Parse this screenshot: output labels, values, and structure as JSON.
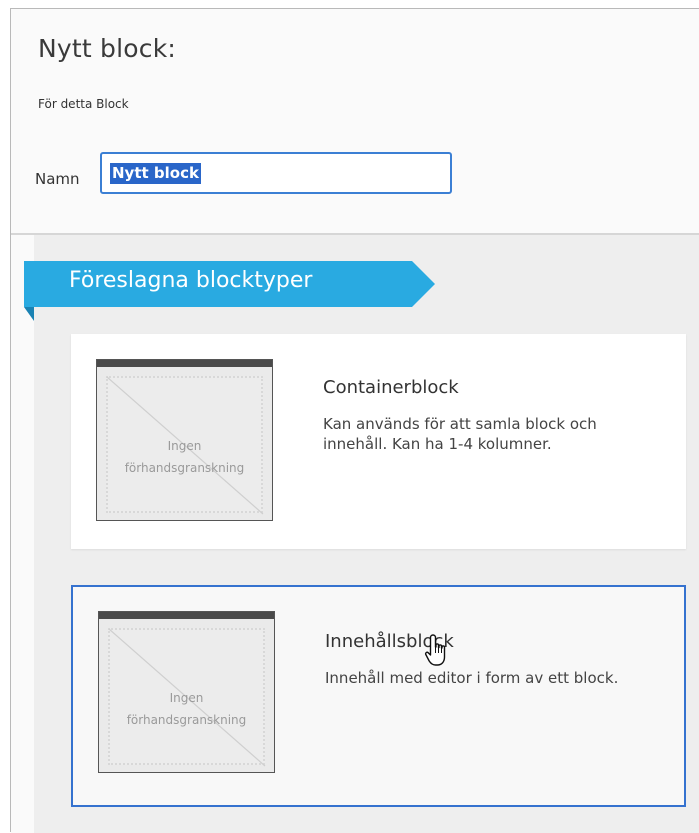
{
  "dialog": {
    "title": "Nytt block:",
    "subtitle": "För detta Block",
    "name_label": "Namn",
    "name_value": "Nytt block"
  },
  "section": {
    "heading": "Föreslagna blocktyper"
  },
  "block_types": [
    {
      "title": "Containerblock",
      "description": "Kan används för att samla block och innehåll. Kan ha 1-4 kolumner.",
      "preview_line1": "Ingen",
      "preview_line2": "förhandsgranskning",
      "selected": false
    },
    {
      "title": "Innehållsblock",
      "description": "Innehåll med editor i form av ett block.",
      "preview_line1": "Ingen",
      "preview_line2": "förhandsgranskning",
      "selected": true
    }
  ],
  "colors": {
    "ribbon": "#29aae1",
    "focus_border": "#3b7fd4",
    "selection": "#2a66c9"
  },
  "cursor": "hand-pointer-icon"
}
